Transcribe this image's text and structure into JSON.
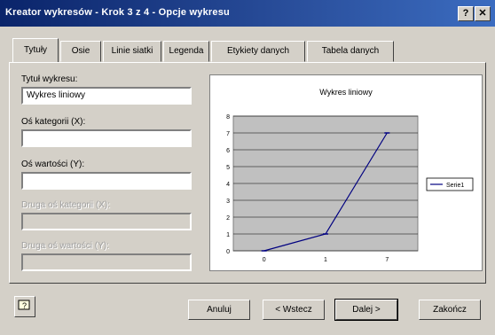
{
  "window": {
    "title": "Kreator wykresów - Krok 3 z 4 - Opcje wykresu",
    "help_label": "?",
    "close_label": "✕"
  },
  "tabs": [
    {
      "label": "Tytuły",
      "active": true
    },
    {
      "label": "Osie"
    },
    {
      "label": "Linie siatki"
    },
    {
      "label": "Legenda"
    },
    {
      "label": "Etykiety danych"
    },
    {
      "label": "Tabela danych"
    }
  ],
  "fields": {
    "chart_title_label": "Tytuł wykresu:",
    "chart_title_value": "Wykres liniowy",
    "category_axis_label": "Oś kategorii (X):",
    "category_axis_value": "",
    "value_axis_label": "Oś wartości (Y):",
    "value_axis_value": "",
    "second_category_label": "Druga oś kategorii (X):",
    "second_value_label": "Druga oś wartości (Y):"
  },
  "preview": {
    "legend_label": "Serie1"
  },
  "chart_data": {
    "type": "line",
    "title": "Wykres liniowy",
    "categories": [
      "0",
      "1",
      "7"
    ],
    "series": [
      {
        "name": "Serie1",
        "values": [
          0,
          1,
          7
        ]
      }
    ],
    "ylim": [
      0,
      8
    ],
    "yticks": [
      0,
      1,
      2,
      3,
      4,
      5,
      6,
      7,
      8
    ],
    "grid": true,
    "legend": "right"
  },
  "buttons": {
    "cancel": "Anuluj",
    "back": "< Wstecz",
    "next": "Dalej >",
    "finish": "Zakończ"
  },
  "colors": {
    "titlebar": "#0a246a",
    "plot_area": "#c0c0c0",
    "series": "#000080"
  }
}
